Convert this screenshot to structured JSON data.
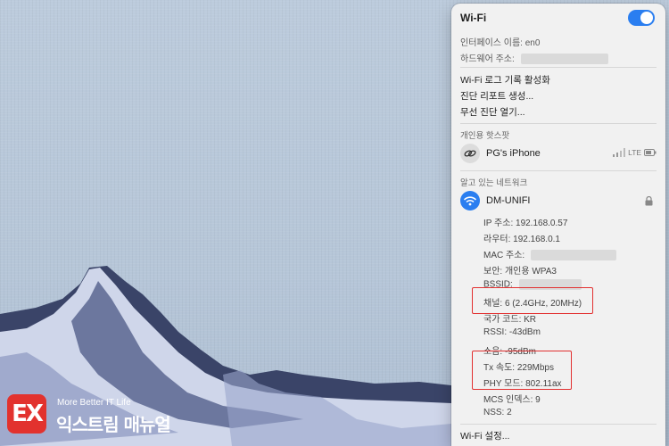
{
  "wifi_menu": {
    "title": "Wi-Fi",
    "interface_name": "인터페이스 이름: en0",
    "hardware_address_label": "하드웨어 주소:",
    "menu_items": [
      "Wi-Fi 로그 기록 활성화",
      "진단 리포트 생성...",
      "무선 진단 열기..."
    ],
    "personal_hotspot": {
      "section": "개인용 핫스팟",
      "device_name": "PG's iPhone",
      "network_type": "LTE"
    },
    "known_networks": {
      "section": "알고 있는 네트워크",
      "name": "DM-UNIFI",
      "details": [
        "IP 주소: 192.168.0.57",
        "라우터: 192.168.0.1",
        "MAC 주소:",
        "보안: 개인용 WPA3",
        "BSSID:",
        "채널: 6 (2.4GHz, 20MHz)",
        "국가 코드: KR",
        "RSSI: -43dBm",
        "소음: -95dBm",
        "Tx 속도: 229Mbps",
        "PHY 모드: 802.11ax",
        "MCS 인덱스: 9",
        "NSS: 2"
      ]
    },
    "settings_label": "Wi-Fi 설정...",
    "accent_color": "#2a7ef0",
    "highlight_color": "#e23030"
  },
  "watermark": {
    "badge": "EX",
    "tagline": "More Better IT Life",
    "name": "익스트림 매뉴얼"
  }
}
